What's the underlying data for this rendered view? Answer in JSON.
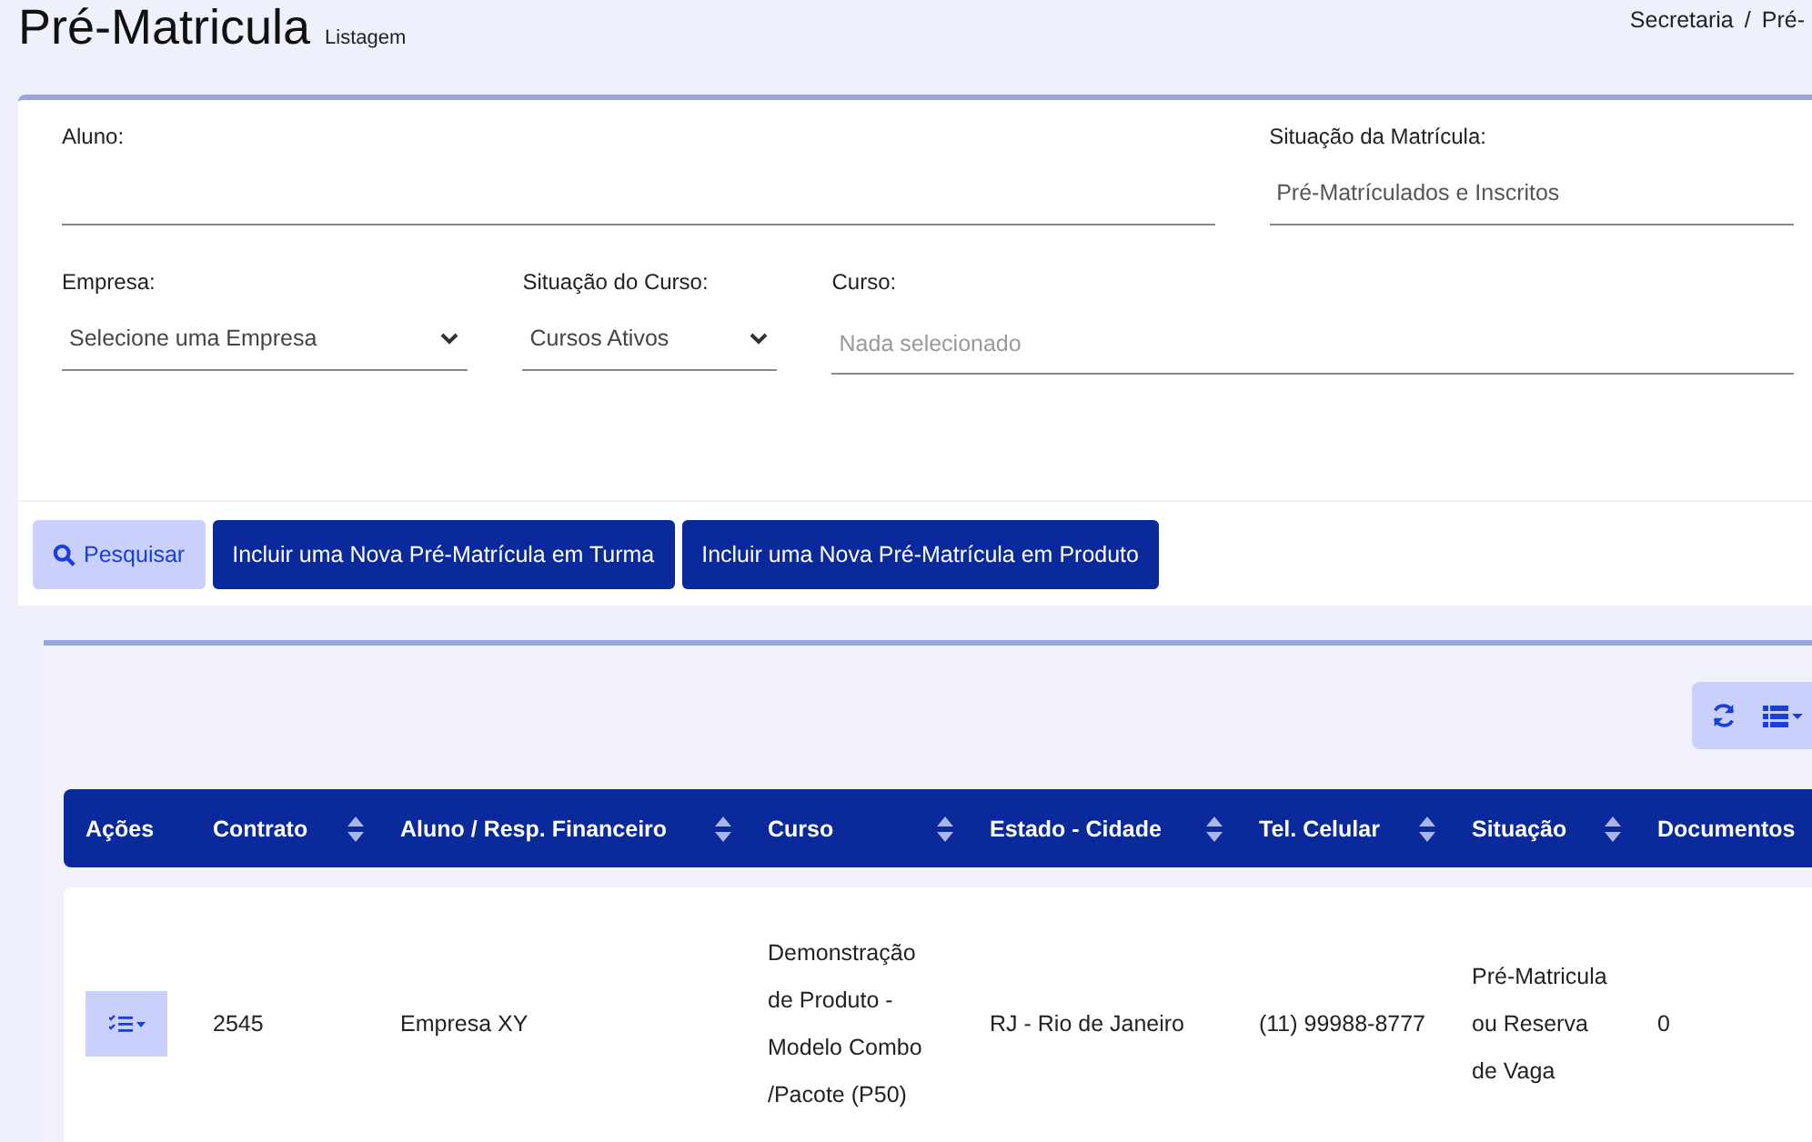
{
  "page": {
    "title": "Pré-Matricula",
    "subtitle": "Listagem"
  },
  "breadcrumb": {
    "items": [
      "Secretaria",
      "Pré-"
    ],
    "separator": "/"
  },
  "filters": [
    {
      "label": "Aluno:",
      "kind": "input"
    },
    {
      "label": "Situação da Matrícula:",
      "kind": "text",
      "value": "Pré-Matrículados e Inscritos"
    }
  ],
  "filters_row2": [
    {
      "label": "Empresa:",
      "kind": "select",
      "value": "Selecione uma Empresa"
    },
    {
      "label": "Situação do Curso:",
      "kind": "select",
      "value": "Cursos Ativos"
    },
    {
      "label": "Curso:",
      "kind": "placeholder",
      "placeholder": "Nada selecionado"
    }
  ],
  "buttons": [
    {
      "label": "Pesquisar",
      "kind": "search"
    },
    {
      "label": "Incluir uma Nova Pré-Matrícula em Turma",
      "kind": "primary"
    },
    {
      "label": "Incluir uma Nova Pré-Matrícula em Produto",
      "kind": "primary"
    }
  ],
  "table": {
    "columns": [
      {
        "label": "Ações",
        "sortable": false
      },
      {
        "label": "Contrato",
        "sortable": true
      },
      {
        "label": "Aluno / Resp. Financeiro",
        "sortable": true
      },
      {
        "label": "Curso",
        "sortable": true
      },
      {
        "label": "Estado - Cidade",
        "sortable": true
      },
      {
        "label": "Tel. Celular",
        "sortable": true
      },
      {
        "label": "Situação",
        "sortable": true
      },
      {
        "label": "Documentos"
      }
    ],
    "rows": [
      {
        "cells": [
          "",
          "2545",
          "Empresa XY",
          "Demonstração de Produto - Modelo Combo /Pacote (P50)",
          "RJ - Rio de Janeiro",
          "(11) 99988-8777",
          "Pré-Matricula ou Reserva de Vaga",
          "0"
        ]
      }
    ]
  }
}
